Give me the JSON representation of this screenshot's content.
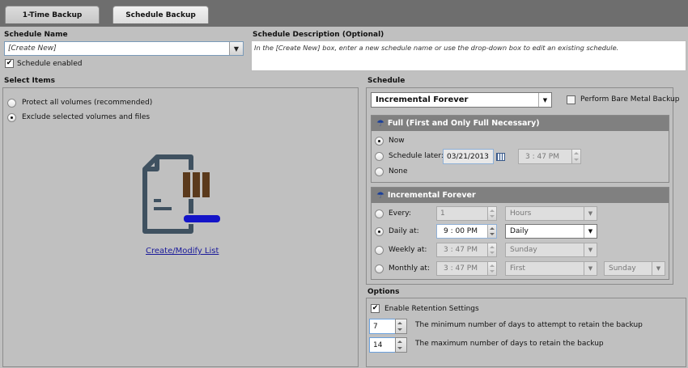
{
  "tabs": [
    {
      "label": "1-Time Backup"
    },
    {
      "label": "Schedule Backup"
    }
  ],
  "schedule_name": {
    "label": "Schedule Name",
    "value": "[Create New]",
    "enabled_label": "Schedule enabled",
    "enabled": true
  },
  "schedule_description": {
    "label": "Schedule Description (Optional)",
    "text": "In the [Create New] box, enter a new schedule name or use the drop-down box to edit an existing schedule."
  },
  "select_items": {
    "label": "Select Items",
    "options": [
      {
        "label": "Protect all volumes (recommended)",
        "selected": false
      },
      {
        "label": "Exclude selected volumes and files",
        "selected": true
      }
    ],
    "link": "Create/Modify List",
    "icon": "document-list-icon"
  },
  "schedule": {
    "label": "Schedule",
    "type": "Incremental Forever",
    "bare_metal_label": "Perform Bare Metal Backup",
    "bare_metal": false,
    "full": {
      "title": "Full (First and Only Full Necessary)",
      "now_label": "Now",
      "later_label": "Schedule later:",
      "date": "03/21/2013",
      "time": "3 : 47 PM",
      "none_label": "None",
      "selected": "now"
    },
    "incremental": {
      "title": "Incremental Forever",
      "every_label": "Every:",
      "every_value": "1",
      "every_unit": "Hours",
      "daily_label": "Daily at:",
      "daily_time": "9 : 00 PM",
      "daily_freq": "Daily",
      "weekly_label": "Weekly at:",
      "weekly_time": "3 : 47 PM",
      "weekly_day": "Sunday",
      "monthly_label": "Monthly at:",
      "monthly_time": "3 : 47 PM",
      "monthly_week": "First",
      "monthly_day": "Sunday",
      "selected": "daily"
    }
  },
  "options": {
    "label": "Options",
    "retention_label": "Enable Retention Settings",
    "retention_enabled": true,
    "min_days": "7",
    "min_label": "The minimum number of days to attempt to retain the backup",
    "max_days": "14",
    "max_label": "The maximum number of days to retain the backup"
  }
}
